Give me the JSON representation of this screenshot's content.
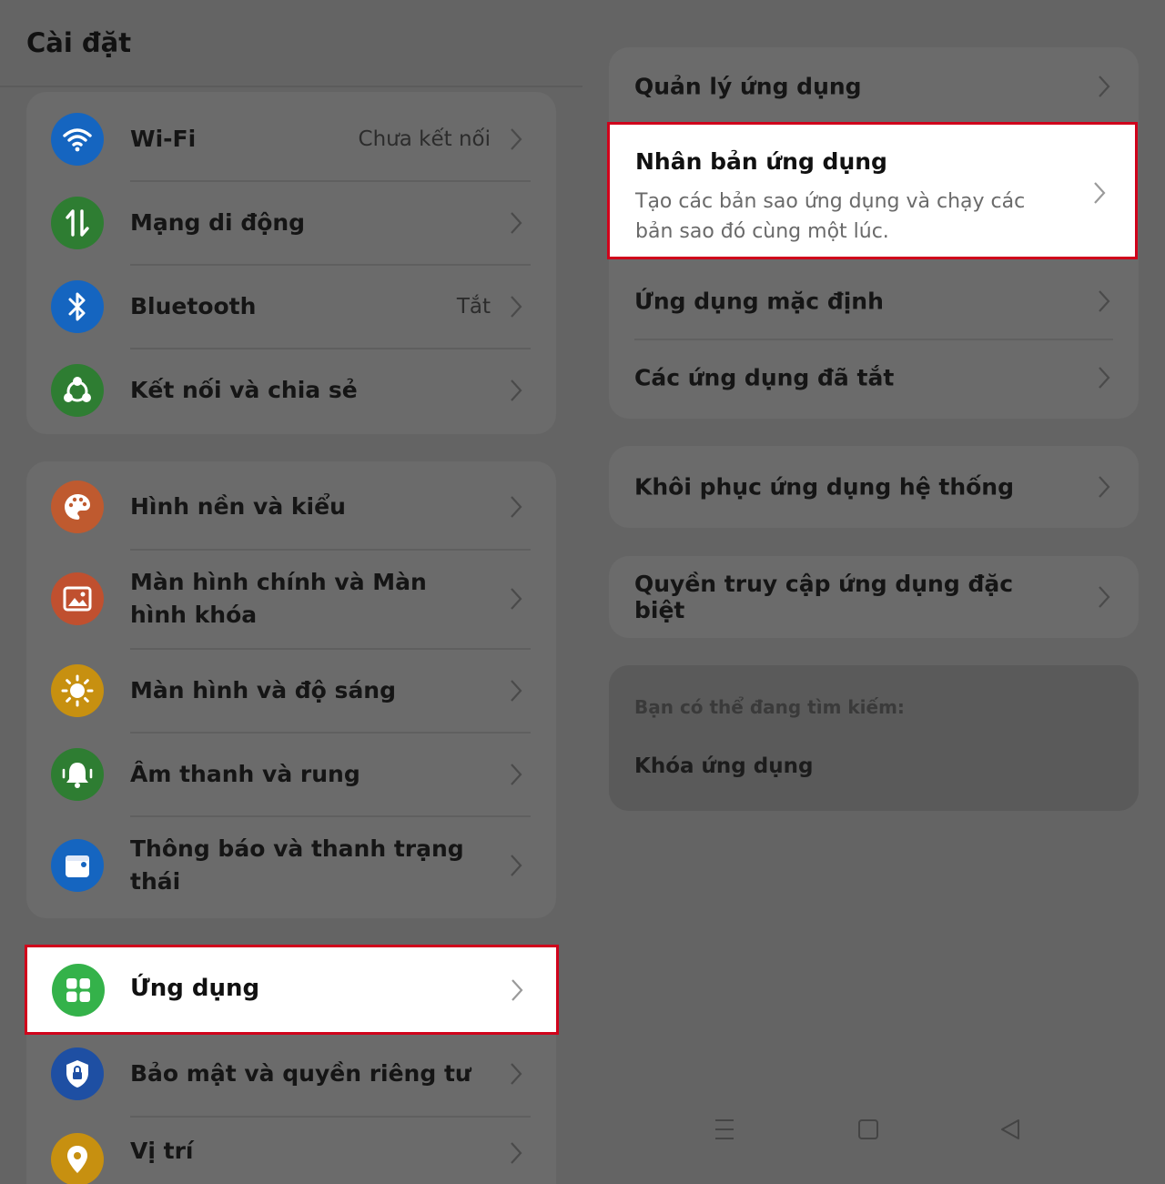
{
  "page_title": "Cài đặt",
  "left": {
    "group1": [
      {
        "label": "Wi-Fi",
        "status": "Chưa kết nối",
        "icon": "wifi-icon",
        "color": "#1565c0"
      },
      {
        "label": "Mạng di động",
        "status": "",
        "icon": "mobile-data-icon",
        "color": "#2e7d32"
      },
      {
        "label": "Bluetooth",
        "status": "Tắt",
        "icon": "bluetooth-icon",
        "color": "#1565c0"
      },
      {
        "label": "Kết nối và chia sẻ",
        "status": "",
        "icon": "share-icon",
        "color": "#2e7d32"
      }
    ],
    "group2": [
      {
        "label": "Hình nền và kiểu",
        "icon": "palette-icon",
        "color": "#bf5a2f"
      },
      {
        "label": "Màn hình chính và Màn hình khóa",
        "icon": "image-icon",
        "color": "#c0502f"
      },
      {
        "label": "Màn hình và độ sáng",
        "icon": "brightness-icon",
        "color": "#c79010"
      },
      {
        "label": "Âm thanh và rung",
        "icon": "bell-icon",
        "color": "#2e7d32"
      },
      {
        "label": "Thông báo và thanh trạng thái",
        "icon": "notification-icon",
        "color": "#1565c0"
      }
    ],
    "apps": {
      "label": "Ứng dụng",
      "icon": "apps-icon",
      "color": "#34b24a"
    },
    "security": {
      "label": "Bảo mật và quyền riêng tư",
      "icon": "shield-lock-icon",
      "color": "#1e4fa3"
    },
    "location": {
      "label": "Vị trí",
      "icon": "location-icon",
      "color": "#c79010"
    }
  },
  "right": {
    "group1": [
      {
        "label": "Quản lý ứng dụng"
      },
      {
        "label": "Nhân bản ứng dụng",
        "description": "Tạo các bản sao ứng dụng và chạy các bản sao đó cùng một lúc."
      },
      {
        "label": "Ứng dụng mặc định"
      },
      {
        "label": "Các ứng dụng đã tắt"
      }
    ],
    "restore": {
      "label": "Khôi phục ứng dụng hệ thống"
    },
    "special": {
      "label": "Quyền truy cập ứng dụng đặc biệt"
    },
    "suggest": {
      "heading": "Bạn có thể đang tìm kiếm:",
      "item": "Khóa ứng dụng"
    }
  },
  "colors": {
    "highlight_border": "#d0021b"
  }
}
